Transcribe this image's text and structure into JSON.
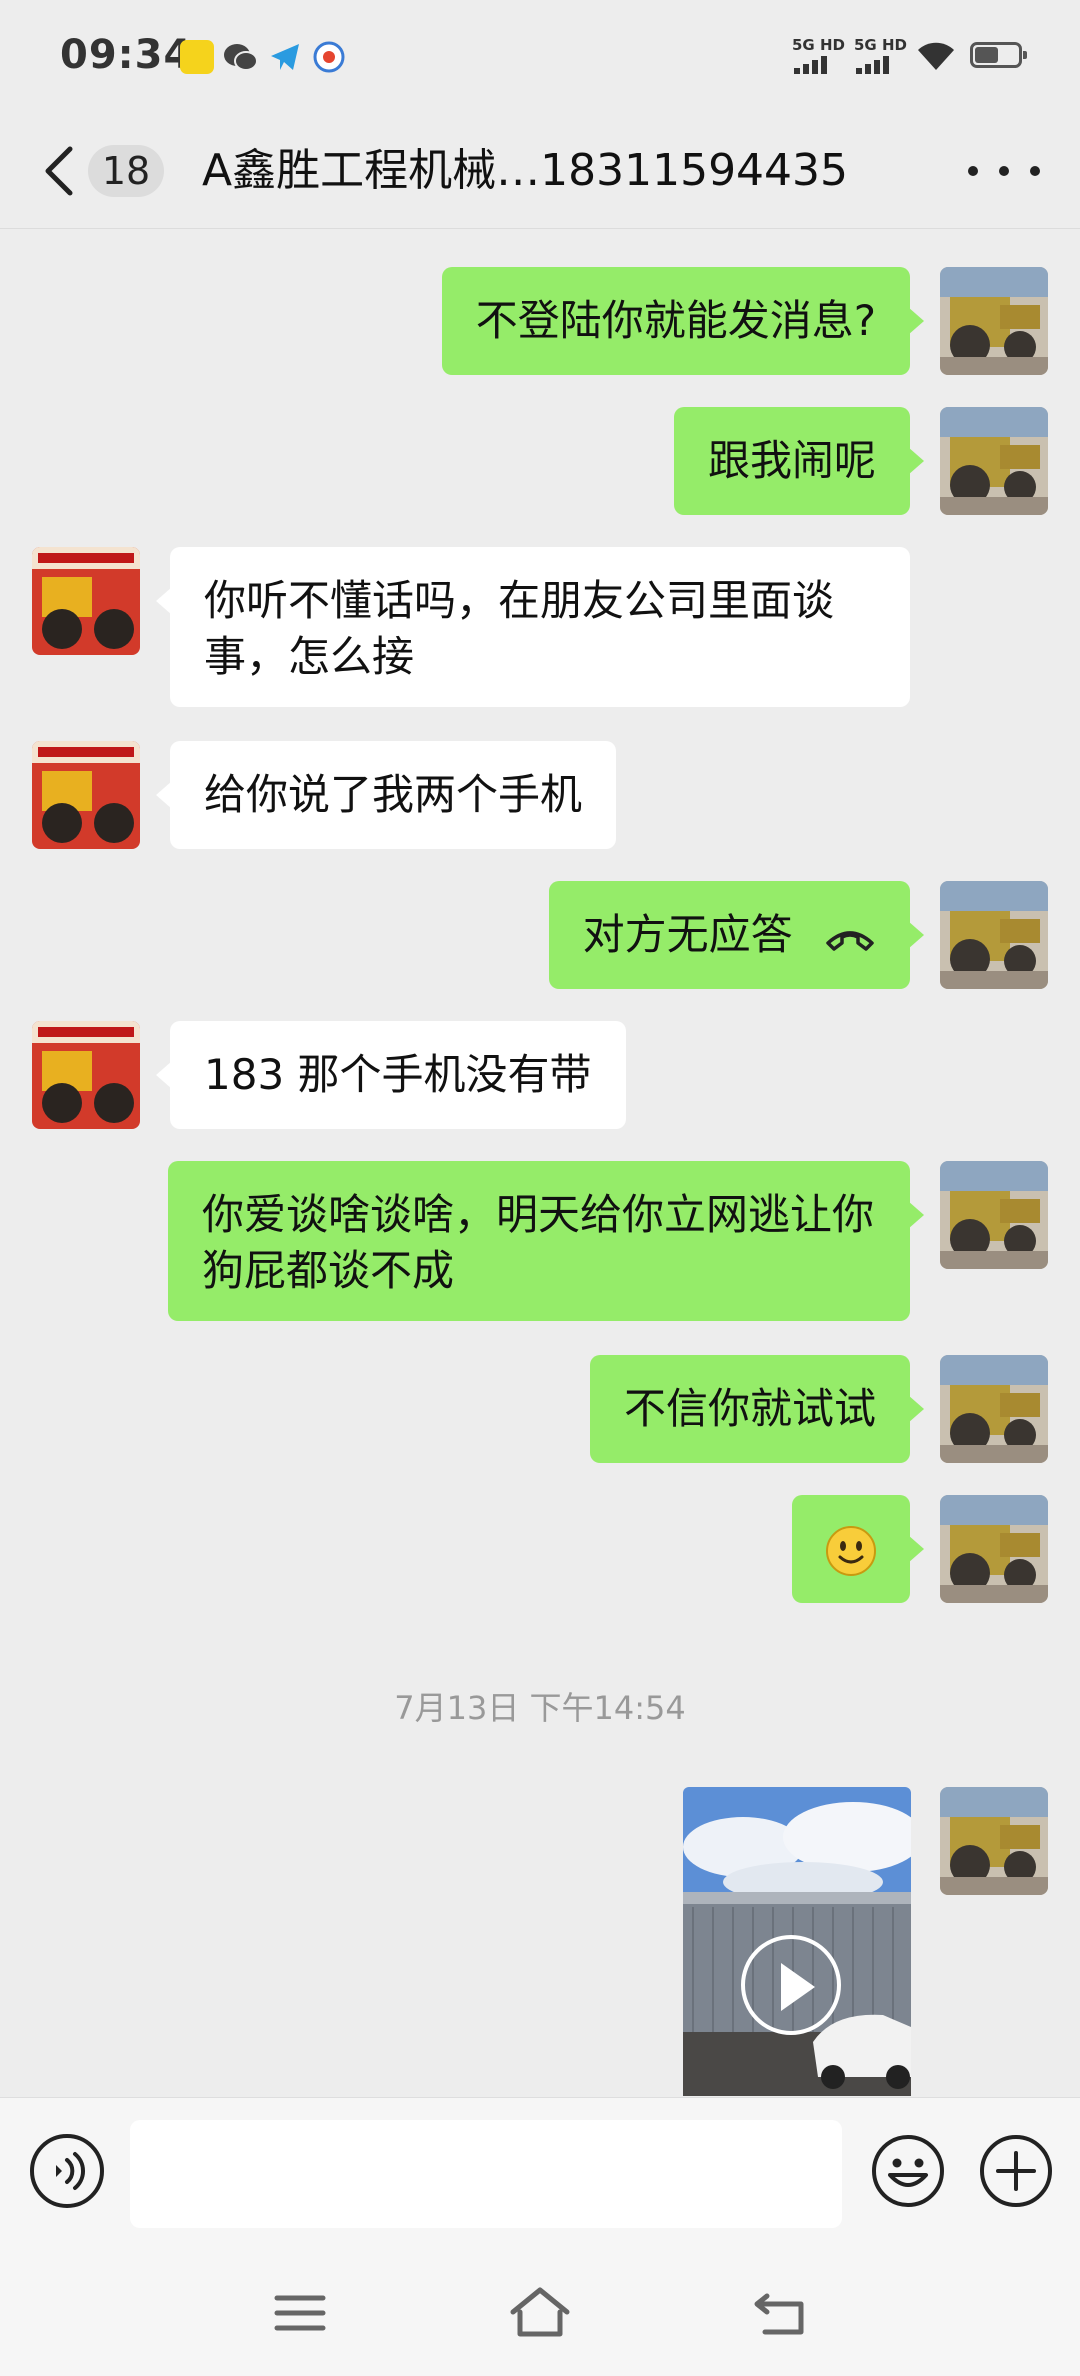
{
  "status_bar": {
    "time": "09:34",
    "signal_1": "5G HD",
    "signal_2": "5G HD",
    "battery_level": 0.55
  },
  "header": {
    "unread_count": "18",
    "title": "A鑫胜工程机械…18311594435"
  },
  "messages": [
    {
      "sender": "me",
      "text": "不登陆你就能发消息?"
    },
    {
      "sender": "me",
      "text": "跟我闹呢"
    },
    {
      "sender": "them",
      "text": "你听不懂话吗，在朋友公司里面谈事，怎么接"
    },
    {
      "sender": "them",
      "text": "给你说了我两个手机"
    },
    {
      "sender": "me",
      "text": "对方无应答",
      "icon": "hangup-icon"
    },
    {
      "sender": "them",
      "text": "183 那个手机没有带"
    },
    {
      "sender": "me",
      "text": "你爱谈啥谈啥，明天给你立网逃让你狗屁都谈不成"
    },
    {
      "sender": "me",
      "text": "不信你就试试"
    },
    {
      "sender": "me",
      "emoji": "🙂"
    },
    {
      "type": "timestamp",
      "text": "7月13日 下午14:54"
    },
    {
      "sender": "me",
      "type": "video",
      "icon": "play-icon"
    }
  ],
  "input": {
    "placeholder": "",
    "value": ""
  },
  "colors": {
    "background": "#ededed",
    "my_bubble": "#95ec69",
    "their_bubble": "#ffffff",
    "timestamp_text": "#999999"
  },
  "icons": {
    "back": "chevron-left-icon",
    "more": "more-dots-icon",
    "voice": "voice-icon",
    "emoji": "smiley-icon",
    "plus": "plus-icon",
    "nav_menu": "menu-icon",
    "nav_home": "home-icon",
    "nav_back": "return-icon"
  }
}
